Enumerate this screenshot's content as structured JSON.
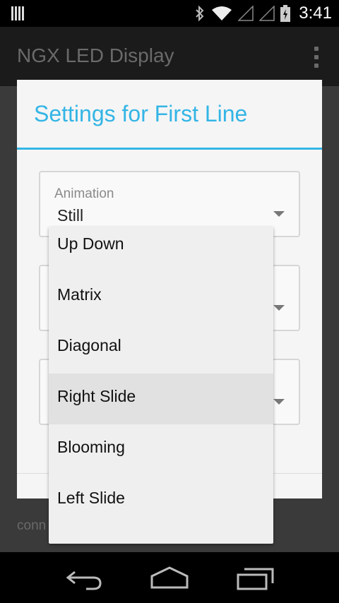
{
  "status_bar": {
    "time": "3:41",
    "icons": [
      "signal-bars-icon",
      "bluetooth-icon",
      "wifi-icon",
      "no-signal-icon",
      "no-signal-icon",
      "battery-charging-icon"
    ]
  },
  "action_bar": {
    "title": "NGX LED Display",
    "overflow_icon": "overflow-menu-icon"
  },
  "background": {
    "partial_text": "conn"
  },
  "dialog": {
    "title": "Settings for First Line",
    "animation_spinner": {
      "label": "Animation",
      "value": "Still"
    }
  },
  "dropdown": {
    "items": [
      {
        "label": "Up Down",
        "highlighted": false
      },
      {
        "label": "Matrix",
        "highlighted": false
      },
      {
        "label": "Diagonal",
        "highlighted": false
      },
      {
        "label": "Right Slide",
        "highlighted": true
      },
      {
        "label": "Blooming",
        "highlighted": false
      },
      {
        "label": "Left Slide",
        "highlighted": false
      }
    ]
  },
  "nav_bar": {
    "buttons": [
      "back-icon",
      "home-icon",
      "recent-apps-icon"
    ]
  },
  "colors": {
    "accent": "#33b5e5",
    "dialog_bg": "#f5f5f5",
    "dropdown_bg": "#efefef",
    "highlight": "#e1e1e1"
  }
}
